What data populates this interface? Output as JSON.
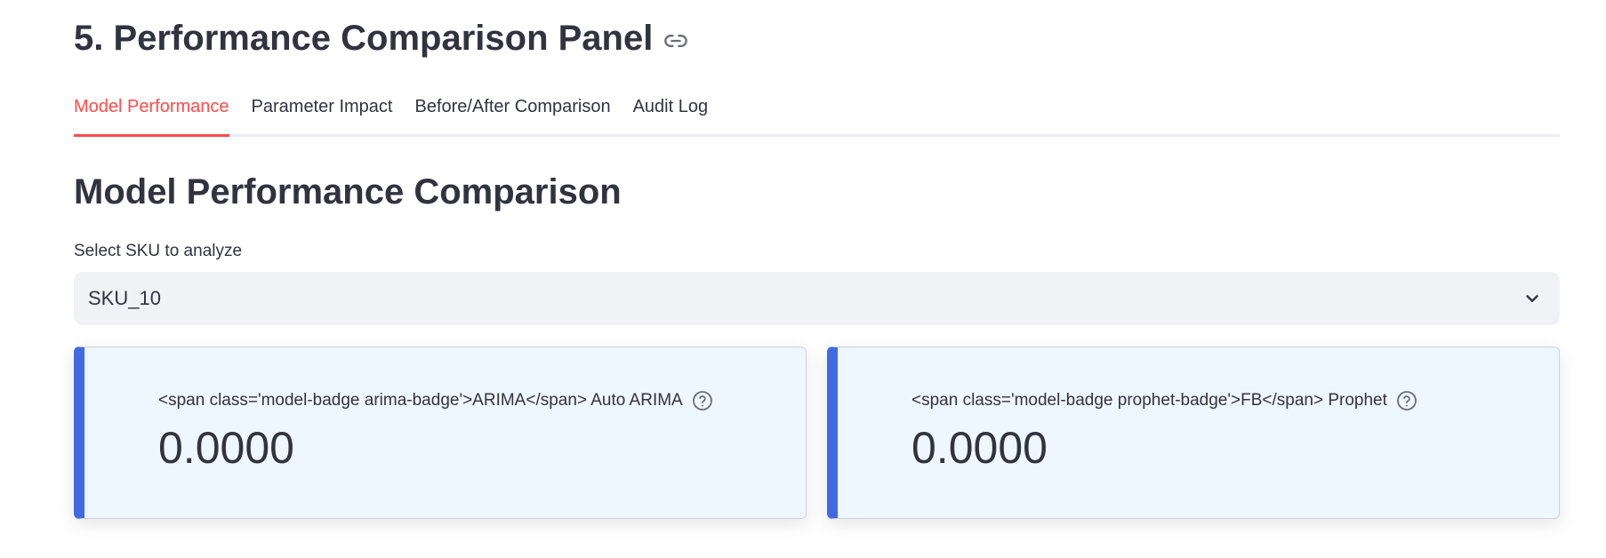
{
  "section": {
    "title": "5. Performance Comparison Panel",
    "link_icon": "link-icon"
  },
  "tabs": [
    {
      "label": "Model Performance",
      "active": true
    },
    {
      "label": "Parameter Impact",
      "active": false
    },
    {
      "label": "Before/After Comparison",
      "active": false
    },
    {
      "label": "Audit Log",
      "active": false
    }
  ],
  "panel": {
    "title": "Model Performance Comparison",
    "select": {
      "label": "Select SKU to analyze",
      "value": "SKU_10",
      "icon": "chevron-down-icon"
    }
  },
  "metrics": [
    {
      "label": "<span class='model-badge arima-badge'>ARIMA</span> Auto ARIMA",
      "value": "0.0000",
      "help_icon": "question-circle-icon"
    },
    {
      "label": "<span class='model-badge prophet-badge'>FB</span> Prophet",
      "value": "0.0000",
      "help_icon": "question-circle-icon"
    }
  ],
  "colors": {
    "accent": "#ff4b4b",
    "card_border_accent": "#4169e1",
    "card_background": "#eef6ff",
    "select_background": "#f0f2f6",
    "text": "#31333f"
  }
}
